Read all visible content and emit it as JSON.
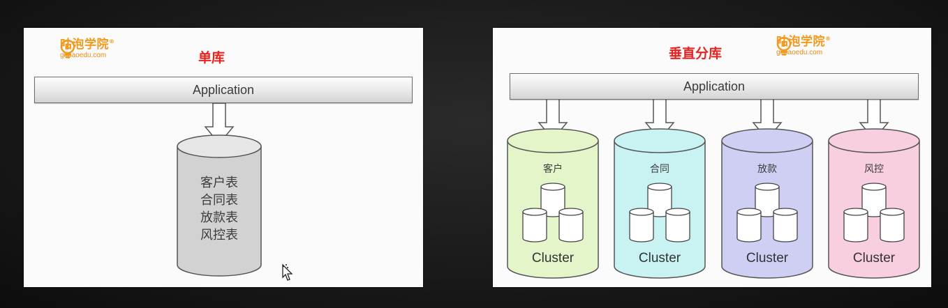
{
  "left_slide": {
    "logo": {
      "name": "咕泡学院",
      "url": "gupaoedu.com"
    },
    "title": "单库",
    "application_label": "Application",
    "database_tables": [
      "客户表",
      "合同表",
      "放款表",
      "风控表"
    ]
  },
  "right_slide": {
    "logo": {
      "name": "咕泡学院",
      "url": "gupaoedu.com"
    },
    "title": "垂直分库",
    "application_label": "Application",
    "clusters": [
      {
        "name": "客户",
        "label": "Cluster",
        "color": "#e4f6c9"
      },
      {
        "name": "合同",
        "label": "Cluster",
        "color": "#c9f3f3"
      },
      {
        "name": "放款",
        "label": "Cluster",
        "color": "#cfcff4"
      },
      {
        "name": "风控",
        "label": "Cluster",
        "color": "#f8cfe0"
      }
    ]
  },
  "colors": {
    "title": "#e8231f",
    "logo": "#f29a1e",
    "db_gray": "#cfcfcf"
  },
  "icons": {
    "logo": "lightbulb-icon",
    "cursor": "pointer-cursor-icon"
  }
}
